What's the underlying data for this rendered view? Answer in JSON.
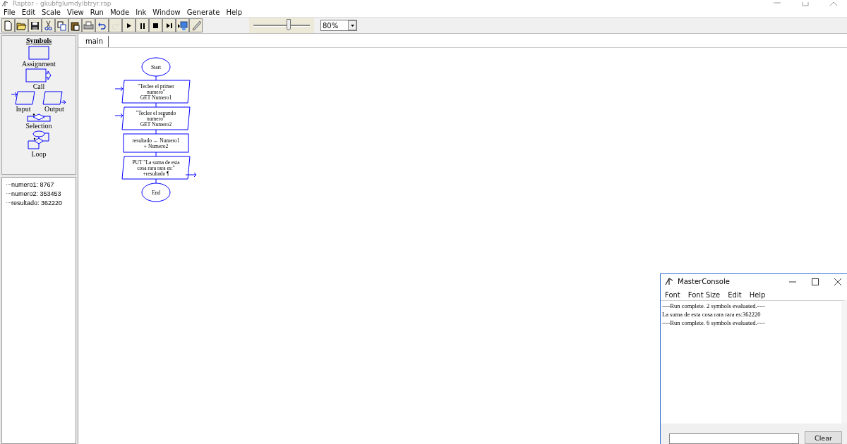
{
  "window": {
    "title": "Raptor - gkubfglumdyibtryr.rap"
  },
  "menu": [
    "File",
    "Edit",
    "Scale",
    "View",
    "Run",
    "Mode",
    "Ink",
    "Window",
    "Generate",
    "Help"
  ],
  "toolbar": [
    {
      "kind": "new",
      "disabled": false
    },
    {
      "kind": "open",
      "disabled": false
    },
    {
      "kind": "save",
      "disabled": false
    },
    {
      "kind": "cut",
      "disabled": false
    },
    {
      "kind": "copy",
      "disabled": false
    },
    {
      "kind": "paste",
      "disabled": false
    },
    {
      "kind": "print",
      "disabled": false
    },
    {
      "kind": "undo",
      "disabled": false
    },
    {
      "kind": "redo",
      "disabled": true
    },
    {
      "kind": "play",
      "disabled": false
    },
    {
      "kind": "pause",
      "disabled": false
    },
    {
      "kind": "stop",
      "disabled": false
    },
    {
      "kind": "step",
      "disabled": false
    },
    {
      "kind": "monitor",
      "disabled": false
    },
    {
      "kind": "pen",
      "disabled": false
    }
  ],
  "zoom": {
    "level": 0.62,
    "value": "80%"
  },
  "symbols": {
    "title": "Symbols",
    "items": [
      {
        "kind": "assignment",
        "label": "Assignment"
      },
      {
        "kind": "call",
        "label": "Call"
      },
      {
        "kind": "input",
        "label": "Input"
      },
      {
        "kind": "output",
        "label": "Output"
      },
      {
        "kind": "selection",
        "label": "Selection"
      },
      {
        "kind": "loop",
        "label": "Loop"
      }
    ]
  },
  "variables": [
    "numero1: 8767",
    "numero2: 353453",
    "resultado: 362220"
  ],
  "tabs": [
    {
      "label": "main",
      "selected": true
    }
  ],
  "flowchart": [
    {
      "kind": "terminal",
      "lines": [
        "Start"
      ]
    },
    {
      "kind": "input",
      "lines": [
        "\"Teclee el primer",
        "numero\"",
        "GET Numero1"
      ]
    },
    {
      "kind": "input",
      "lines": [
        "\"Teclee el segundo",
        "numero\"",
        "GET Numero2"
      ]
    },
    {
      "kind": "assignment",
      "lines": [
        "resultado ← Numero1",
        "+ Numero2"
      ]
    },
    {
      "kind": "output",
      "lines": [
        "PUT \"La suma de esta",
        "cosa rara rara es:\"",
        "+resultado ¶"
      ]
    },
    {
      "kind": "terminal",
      "lines": [
        "End"
      ]
    }
  ],
  "console": {
    "title": "MasterConsole",
    "menu": [
      "Font",
      "Font Size",
      "Edit",
      "Help"
    ],
    "lines": [
      "----Run complete.  2 symbols evaluated.----",
      "La suma de esta cosa rara rara es:362220",
      "----Run complete.  6 symbols evaluated.----"
    ],
    "button": "Clear"
  }
}
